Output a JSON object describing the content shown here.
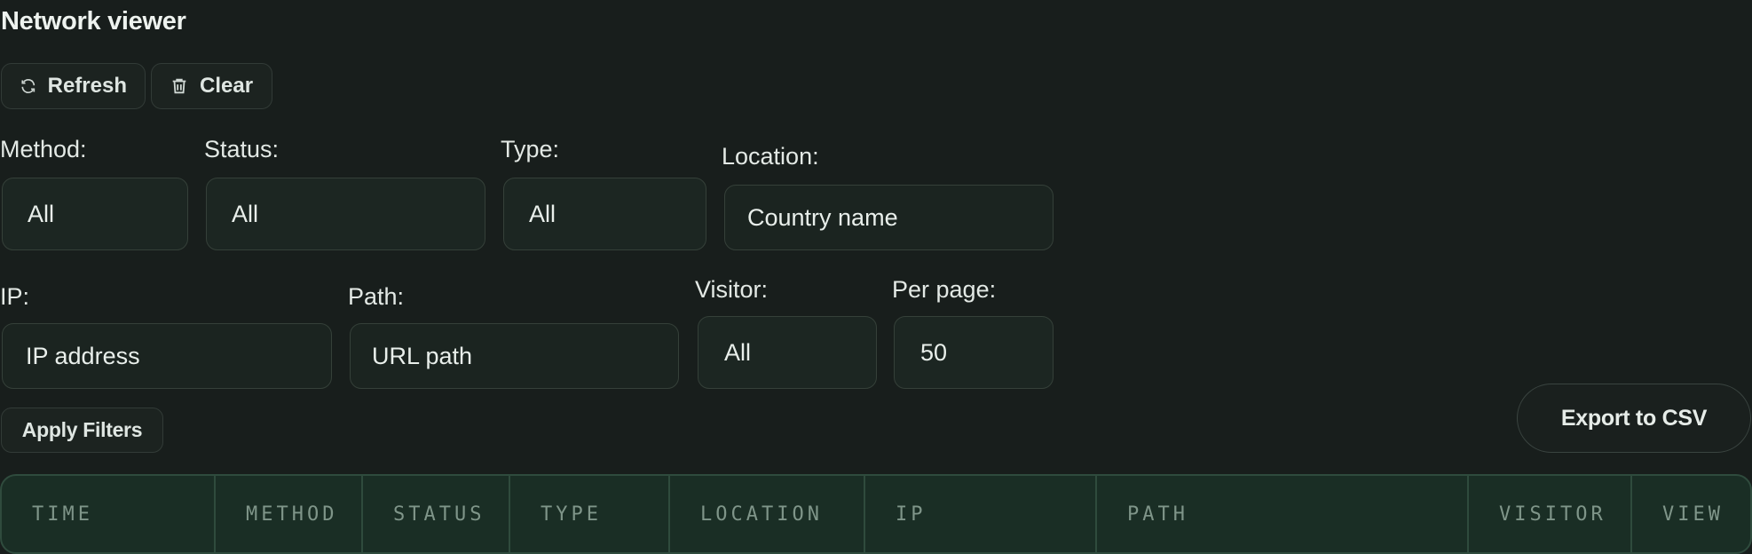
{
  "header": {
    "title": "Network viewer"
  },
  "toolbar": {
    "refresh_label": "Refresh",
    "clear_label": "Clear"
  },
  "filters": {
    "method": {
      "label": "Method:",
      "value": "All"
    },
    "status": {
      "label": "Status:",
      "value": "All"
    },
    "type": {
      "label": "Type:",
      "value": "All"
    },
    "location": {
      "label": "Location:",
      "placeholder": "Country name"
    },
    "ip": {
      "label": "IP:",
      "placeholder": "IP address"
    },
    "path": {
      "label": "Path:",
      "placeholder": "URL path"
    },
    "visitor": {
      "label": "Visitor:",
      "value": "All"
    },
    "per_page": {
      "label": "Per page:",
      "value": "50"
    },
    "apply_label": "Apply Filters"
  },
  "export_label": "Export to CSV",
  "table": {
    "columns": [
      "TIME",
      "METHOD",
      "STATUS",
      "TYPE",
      "LOCATION",
      "IP",
      "PATH",
      "VISITOR",
      "VIEW"
    ]
  }
}
